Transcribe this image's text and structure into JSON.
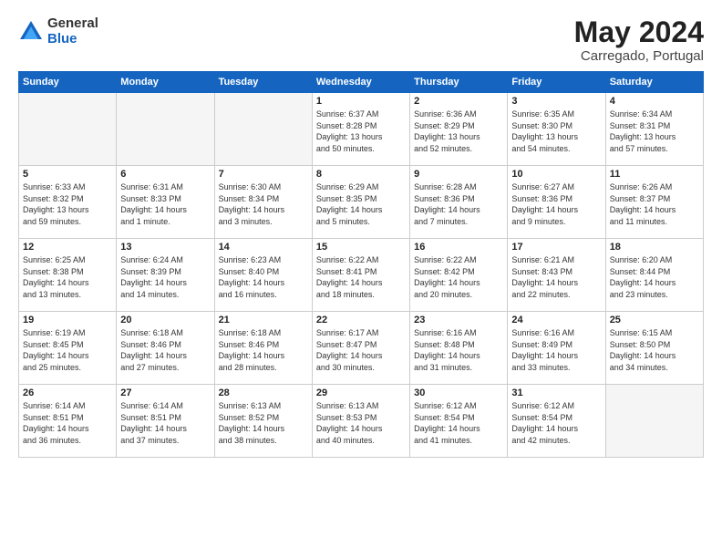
{
  "header": {
    "logo": {
      "general": "General",
      "blue": "Blue"
    },
    "title": "May 2024",
    "location": "Carregado, Portugal"
  },
  "days_of_week": [
    "Sunday",
    "Monday",
    "Tuesday",
    "Wednesday",
    "Thursday",
    "Friday",
    "Saturday"
  ],
  "weeks": [
    [
      {
        "day": "",
        "info": ""
      },
      {
        "day": "",
        "info": ""
      },
      {
        "day": "",
        "info": ""
      },
      {
        "day": "1",
        "info": "Sunrise: 6:37 AM\nSunset: 8:28 PM\nDaylight: 13 hours\nand 50 minutes."
      },
      {
        "day": "2",
        "info": "Sunrise: 6:36 AM\nSunset: 8:29 PM\nDaylight: 13 hours\nand 52 minutes."
      },
      {
        "day": "3",
        "info": "Sunrise: 6:35 AM\nSunset: 8:30 PM\nDaylight: 13 hours\nand 54 minutes."
      },
      {
        "day": "4",
        "info": "Sunrise: 6:34 AM\nSunset: 8:31 PM\nDaylight: 13 hours\nand 57 minutes."
      }
    ],
    [
      {
        "day": "5",
        "info": "Sunrise: 6:33 AM\nSunset: 8:32 PM\nDaylight: 13 hours\nand 59 minutes."
      },
      {
        "day": "6",
        "info": "Sunrise: 6:31 AM\nSunset: 8:33 PM\nDaylight: 14 hours\nand 1 minute."
      },
      {
        "day": "7",
        "info": "Sunrise: 6:30 AM\nSunset: 8:34 PM\nDaylight: 14 hours\nand 3 minutes."
      },
      {
        "day": "8",
        "info": "Sunrise: 6:29 AM\nSunset: 8:35 PM\nDaylight: 14 hours\nand 5 minutes."
      },
      {
        "day": "9",
        "info": "Sunrise: 6:28 AM\nSunset: 8:36 PM\nDaylight: 14 hours\nand 7 minutes."
      },
      {
        "day": "10",
        "info": "Sunrise: 6:27 AM\nSunset: 8:36 PM\nDaylight: 14 hours\nand 9 minutes."
      },
      {
        "day": "11",
        "info": "Sunrise: 6:26 AM\nSunset: 8:37 PM\nDaylight: 14 hours\nand 11 minutes."
      }
    ],
    [
      {
        "day": "12",
        "info": "Sunrise: 6:25 AM\nSunset: 8:38 PM\nDaylight: 14 hours\nand 13 minutes."
      },
      {
        "day": "13",
        "info": "Sunrise: 6:24 AM\nSunset: 8:39 PM\nDaylight: 14 hours\nand 14 minutes."
      },
      {
        "day": "14",
        "info": "Sunrise: 6:23 AM\nSunset: 8:40 PM\nDaylight: 14 hours\nand 16 minutes."
      },
      {
        "day": "15",
        "info": "Sunrise: 6:22 AM\nSunset: 8:41 PM\nDaylight: 14 hours\nand 18 minutes."
      },
      {
        "day": "16",
        "info": "Sunrise: 6:22 AM\nSunset: 8:42 PM\nDaylight: 14 hours\nand 20 minutes."
      },
      {
        "day": "17",
        "info": "Sunrise: 6:21 AM\nSunset: 8:43 PM\nDaylight: 14 hours\nand 22 minutes."
      },
      {
        "day": "18",
        "info": "Sunrise: 6:20 AM\nSunset: 8:44 PM\nDaylight: 14 hours\nand 23 minutes."
      }
    ],
    [
      {
        "day": "19",
        "info": "Sunrise: 6:19 AM\nSunset: 8:45 PM\nDaylight: 14 hours\nand 25 minutes."
      },
      {
        "day": "20",
        "info": "Sunrise: 6:18 AM\nSunset: 8:46 PM\nDaylight: 14 hours\nand 27 minutes."
      },
      {
        "day": "21",
        "info": "Sunrise: 6:18 AM\nSunset: 8:46 PM\nDaylight: 14 hours\nand 28 minutes."
      },
      {
        "day": "22",
        "info": "Sunrise: 6:17 AM\nSunset: 8:47 PM\nDaylight: 14 hours\nand 30 minutes."
      },
      {
        "day": "23",
        "info": "Sunrise: 6:16 AM\nSunset: 8:48 PM\nDaylight: 14 hours\nand 31 minutes."
      },
      {
        "day": "24",
        "info": "Sunrise: 6:16 AM\nSunset: 8:49 PM\nDaylight: 14 hours\nand 33 minutes."
      },
      {
        "day": "25",
        "info": "Sunrise: 6:15 AM\nSunset: 8:50 PM\nDaylight: 14 hours\nand 34 minutes."
      }
    ],
    [
      {
        "day": "26",
        "info": "Sunrise: 6:14 AM\nSunset: 8:51 PM\nDaylight: 14 hours\nand 36 minutes."
      },
      {
        "day": "27",
        "info": "Sunrise: 6:14 AM\nSunset: 8:51 PM\nDaylight: 14 hours\nand 37 minutes."
      },
      {
        "day": "28",
        "info": "Sunrise: 6:13 AM\nSunset: 8:52 PM\nDaylight: 14 hours\nand 38 minutes."
      },
      {
        "day": "29",
        "info": "Sunrise: 6:13 AM\nSunset: 8:53 PM\nDaylight: 14 hours\nand 40 minutes."
      },
      {
        "day": "30",
        "info": "Sunrise: 6:12 AM\nSunset: 8:54 PM\nDaylight: 14 hours\nand 41 minutes."
      },
      {
        "day": "31",
        "info": "Sunrise: 6:12 AM\nSunset: 8:54 PM\nDaylight: 14 hours\nand 42 minutes."
      },
      {
        "day": "",
        "info": ""
      }
    ]
  ]
}
